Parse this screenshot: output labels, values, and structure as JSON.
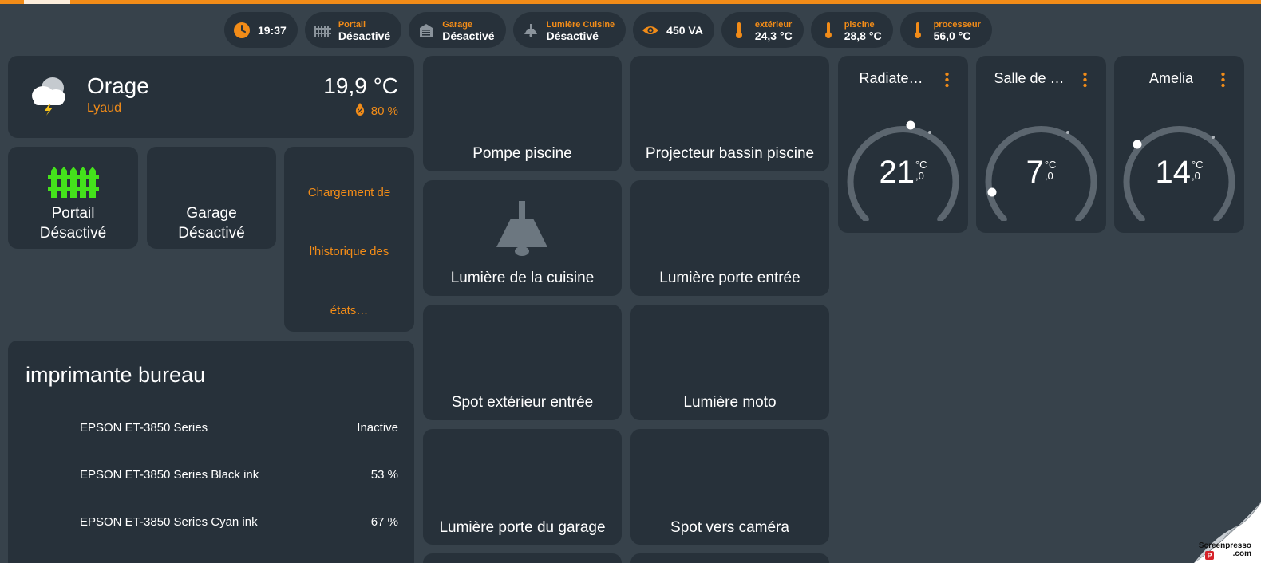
{
  "badges": [
    {
      "id": "clock",
      "icon": "clock-icon",
      "value": "19:37"
    },
    {
      "id": "portail",
      "icon": "fence-icon",
      "label": "Portail",
      "value": "Désactivé"
    },
    {
      "id": "garage",
      "icon": "garage-icon",
      "label": "Garage",
      "value": "Désactivé"
    },
    {
      "id": "lumiere-cuisine",
      "icon": "ceiling-lamp-icon",
      "label": "Lumière Cuisine",
      "value": "Désactivé"
    },
    {
      "id": "power",
      "icon": "eye-icon",
      "value": "450 VA"
    },
    {
      "id": "exterieur",
      "icon": "thermometer-icon",
      "label": "extérieur",
      "value": "24,3 °C"
    },
    {
      "id": "piscine",
      "icon": "thermometer-icon",
      "label": "piscine",
      "value": "28,8 °C"
    },
    {
      "id": "processeur",
      "icon": "thermometer-icon",
      "label": "processeur",
      "value": "56,0 °C"
    }
  ],
  "weather": {
    "condition": "Orage",
    "location": "Lyaud",
    "temperature": "19,9 °C",
    "humidity": "80 %",
    "icon": "thunderstorm-cloud-icon"
  },
  "tiles": {
    "portail": {
      "name": "Portail",
      "state": "Désactivé",
      "icon": "fence-icon",
      "icon_color": "#44e21b"
    },
    "garage": {
      "name": "Garage",
      "state": "Désactivé"
    }
  },
  "history": {
    "line1": "Chargement de",
    "line2": "l'historique des",
    "line3": "états…"
  },
  "printer": {
    "title": "imprimante bureau",
    "rows": [
      {
        "name": "EPSON ET-3850 Series",
        "value": "Inactive"
      },
      {
        "name": "EPSON ET-3850 Series Black ink",
        "value": "53 %"
      },
      {
        "name": "EPSON ET-3850 Series Cyan ink",
        "value": "67 %"
      }
    ]
  },
  "buttons": {
    "pompe_piscine": "Pompe piscine",
    "projecteur_bassin": "Projecteur bassin piscine",
    "lumiere_cuisine": "Lumière de la cuisine",
    "lumiere_porte_entree": "Lumière porte entrée",
    "spot_exterieur": "Spot extérieur entrée",
    "lumiere_moto": "Lumière moto",
    "lumiere_porte_garage": "Lumière porte du garage",
    "spot_camera": "Spot vers caméra"
  },
  "thermostats": [
    {
      "name": "Radiate…",
      "temp_int": "21",
      "unit": "°C",
      "decimal": ",0"
    },
    {
      "name": "Salle de …",
      "temp_int": "7",
      "unit": "°C",
      "decimal": ",0"
    },
    {
      "name": "Amelia",
      "temp_int": "14",
      "unit": "°C",
      "decimal": ",0"
    }
  ],
  "watermark": {
    "line1": "Screenpresso",
    "line2": ".com"
  },
  "colors": {
    "accent": "#f28c18",
    "card": "#27313a",
    "background": "#37424b",
    "fence_active": "#44e21b",
    "icon_grey": "#8a939b"
  }
}
